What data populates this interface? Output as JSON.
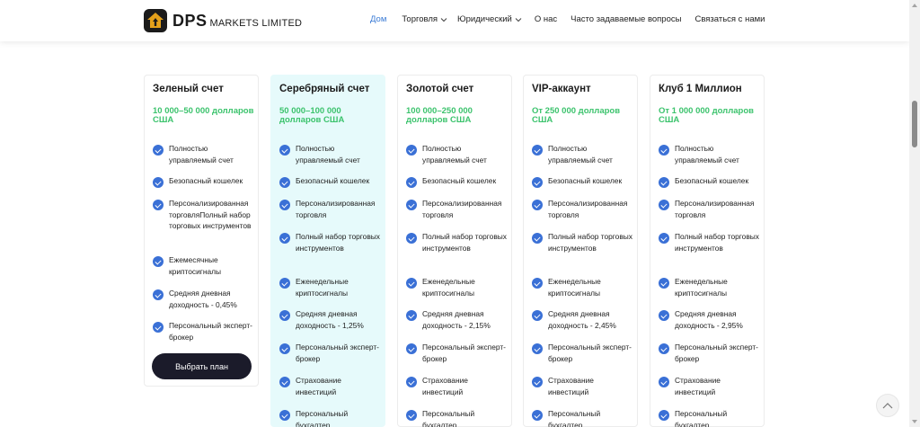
{
  "brand": {
    "name": "DPS",
    "sub": "MARKETS LIMITED"
  },
  "nav": [
    {
      "label": "Дом",
      "active": true,
      "dropdown": false
    },
    {
      "label": "Торговля",
      "active": false,
      "dropdown": true
    },
    {
      "label": "Юридический",
      "active": false,
      "dropdown": true
    },
    {
      "label": "О нас",
      "active": false,
      "dropdown": false
    },
    {
      "label": "Часто задаваемые вопросы",
      "active": false,
      "dropdown": false
    },
    {
      "label": "Связаться с нами",
      "active": false,
      "dropdown": false
    }
  ],
  "plans": [
    {
      "title": "Зеленый счет",
      "price": "10 000–50 000 долларов США",
      "features": [
        "Полностью управляемый счет",
        "Безопасный кошелек",
        "Персонализированная торговляПолный набор торговых инструментов",
        "Ежемесячные криптосигналы",
        "Средняя дневная доходность - 0,45%",
        " Персональный эксперт-брокер"
      ],
      "button": "Выбрать план"
    },
    {
      "title": "Серебряный счет",
      "price": "50 000–100 000 долларов США",
      "features": [
        "Полностью управляемый счет",
        "Безопасный кошелек",
        "Персонализированная торговля",
        "Полный набор торговых инструментов",
        "Еженедельные криптосигналы",
        "Средняя дневная доходность - 1,25%",
        " Персональный эксперт-брокер",
        "Страхование инвестиций",
        "Персональный бухгалтер"
      ]
    },
    {
      "title": "Золотой счет",
      "price": "100 000–250 000 долларов США",
      "features": [
        "Полностью управляемый счет",
        "Безопасный кошелек",
        "Персонализированная торговля",
        "Полный набор торговых инструментов",
        "Еженедельные криптосигналы",
        "Средняя дневная доходность - 2,15%",
        " Персональный эксперт-брокер",
        "Страхование инвестиций",
        "Персональный бухгалтер"
      ]
    },
    {
      "title": "VIP-аккаунт",
      "price": "От 250 000 долларов США",
      "features": [
        "Полностью управляемый счет",
        "Безопасный кошелек",
        "Персонализированная торговля",
        "Полный набор торговых инструментов",
        "Еженедельные криптосигналы",
        "Средняя дневная доходность - 2,45%",
        " Персональный эксперт-брокер",
        "Страхование инвестиций",
        "Персональный бухгалтер"
      ]
    },
    {
      "title": "Клуб 1 Миллион",
      "price": "От 1 000 000 долларов США",
      "features": [
        "Полностью управляемый счет",
        "Безопасный кошелек",
        "Персонализированная торговля",
        "Полный набор торговых инструментов",
        "Еженедельные криптосигналы",
        "Средняя дневная доходность - 2,95%",
        " Персональный эксперт-брокер",
        "Страхование инвестиций",
        "Персональный бухгалтер"
      ]
    }
  ],
  "colors": {
    "accent": "#3a7bd5",
    "price": "#3cc36d",
    "check": "#3a70d6",
    "highlight": "#e6fafb",
    "button": "#1b1b2a"
  },
  "icons": {
    "check": "check-circle-icon",
    "chevron": "chevron-down-icon",
    "scroll_top": "chevron-up-icon",
    "logo": "house-arrow-icon"
  }
}
